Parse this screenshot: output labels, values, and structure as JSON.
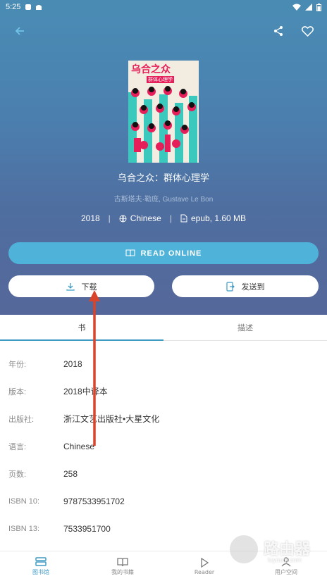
{
  "status_bar": {
    "time": "5:25"
  },
  "book": {
    "title": "乌合之众：群体心理学",
    "author": "古斯塔夫·勒庞, Gustave Le Bon",
    "year": "2018",
    "language": "Chinese",
    "format": "epub, 1.60 MB",
    "cover_title": "乌合之众",
    "cover_subtitle": "群体心理学"
  },
  "actions": {
    "read_online": "READ ONLINE",
    "download": "下载",
    "send_to": "发送到"
  },
  "tabs": [
    {
      "label": "书",
      "active": true
    },
    {
      "label": "描述",
      "active": false
    }
  ],
  "details": [
    {
      "label": "年份:",
      "value": "2018"
    },
    {
      "label": "版本:",
      "value": "2018中译本"
    },
    {
      "label": "出版社:",
      "value": "浙江文艺出版社•大星文化"
    },
    {
      "label": "语言:",
      "value": "Chinese"
    },
    {
      "label": "页数:",
      "value": "258"
    },
    {
      "label": "ISBN 10:",
      "value": "9787533951702"
    },
    {
      "label": "ISBN 13:",
      "value": "7533951700"
    }
  ],
  "bottom_nav": [
    {
      "label": "图书馆",
      "icon": "library-icon",
      "active": true
    },
    {
      "label": "我的书籍",
      "icon": "book-open-icon",
      "active": false
    },
    {
      "label": "Reader",
      "icon": "play-icon",
      "active": false
    },
    {
      "label": "用户空间",
      "icon": "user-icon",
      "active": false
    }
  ],
  "watermark": {
    "text": "路由器",
    "sub": "luyouqi.com"
  },
  "colors": {
    "accent": "#3f9bc4",
    "read_online_bg": "#4fb3d9",
    "annotation_arrow": "#d9442b"
  }
}
